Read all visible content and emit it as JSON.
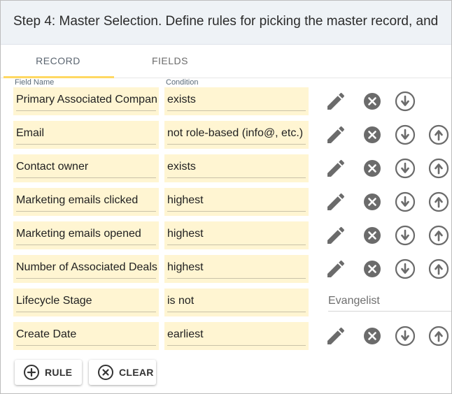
{
  "header": {
    "title": "Step 4: Master Selection. Define rules for picking the master record, and"
  },
  "tabs": [
    {
      "label": "RECORD",
      "active": true
    },
    {
      "label": "FIELDS",
      "active": false
    }
  ],
  "columns": {
    "field": "Field Name",
    "condition": "Condition"
  },
  "rows": [
    {
      "field": "Primary Associated Company",
      "condition": "exists"
    },
    {
      "field": "Email",
      "condition": "not role-based (info@, etc.)"
    },
    {
      "field": "Contact owner",
      "condition": "exists"
    },
    {
      "field": "Marketing emails clicked",
      "condition": "highest"
    },
    {
      "field": "Marketing emails opened",
      "condition": "highest"
    },
    {
      "field": "Number of Associated Deals",
      "condition": "highest"
    },
    {
      "field": "Lifecycle Stage",
      "condition": "is not",
      "value": "Evangelist"
    },
    {
      "field": "Create Date",
      "condition": "earliest"
    }
  ],
  "buttons": {
    "rule": "RULE",
    "clear": "CLEAR"
  },
  "icons": {
    "edit": "pencil-icon",
    "remove": "remove-circle-icon",
    "move_down": "arrow-down-circle-icon",
    "move_up": "arrow-up-circle-icon"
  },
  "colors": {
    "field_bg": "#fff5d2",
    "tab_indicator": "#ffd862",
    "header_bg": "#eef2f6",
    "icon": "#6b6b6b"
  }
}
